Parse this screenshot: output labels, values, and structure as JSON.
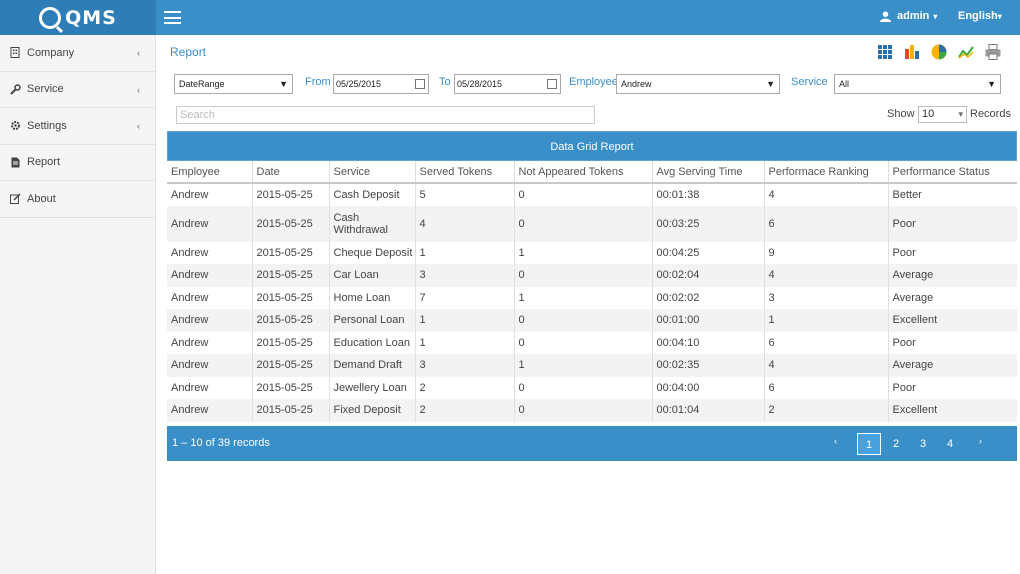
{
  "app": {
    "logo_text": "QMS"
  },
  "header": {
    "user": "admin",
    "language": "English"
  },
  "sidebar": {
    "items": [
      {
        "label": "Company",
        "icon": "building-icon"
      },
      {
        "label": "Service",
        "icon": "wrench-icon"
      },
      {
        "label": "Settings",
        "icon": "gear-icon"
      },
      {
        "label": "Report",
        "icon": "document-icon"
      },
      {
        "label": "About",
        "icon": "edit-icon"
      }
    ]
  },
  "main": {
    "breadcrumb": "Report",
    "filters": {
      "range_type": "DateRange",
      "from_label": "From",
      "from_value": "05/25/2015",
      "to_label": "To",
      "to_value": "05/28/2015",
      "employee_label": "Employee",
      "employee_value": "Andrew",
      "service_label": "Service",
      "service_value": "All"
    },
    "search_placeholder": "Search",
    "show_label": "Show",
    "show_value": "10",
    "records_label": "Records",
    "grid_title": "Data Grid Report",
    "columns": [
      "Employee",
      "Date",
      "Service",
      "Served Tokens",
      "Not Appeared Tokens",
      "Avg Serving Time",
      "Performace Ranking",
      "Performance Status"
    ],
    "rows": [
      [
        "Andrew",
        "2015-05-25",
        "Cash Deposit",
        "5",
        "0",
        "00:01:38",
        "4",
        "Better"
      ],
      [
        "Andrew",
        "2015-05-25",
        "Cash Withdrawal",
        "4",
        "0",
        "00:03:25",
        "6",
        "Poor"
      ],
      [
        "Andrew",
        "2015-05-25",
        "Cheque Deposit",
        "1",
        "1",
        "00:04:25",
        "9",
        "Poor"
      ],
      [
        "Andrew",
        "2015-05-25",
        "Car Loan",
        "3",
        "0",
        "00:02:04",
        "4",
        "Average"
      ],
      [
        "Andrew",
        "2015-05-25",
        "Home Loan",
        "7",
        "1",
        "00:02:02",
        "3",
        "Average"
      ],
      [
        "Andrew",
        "2015-05-25",
        "Personal Loan",
        "1",
        "0",
        "00:01:00",
        "1",
        "Excellent"
      ],
      [
        "Andrew",
        "2015-05-25",
        "Education Loan",
        "1",
        "0",
        "00:04:10",
        "6",
        "Poor"
      ],
      [
        "Andrew",
        "2015-05-25",
        "Demand Draft",
        "3",
        "1",
        "00:02:35",
        "4",
        "Average"
      ],
      [
        "Andrew",
        "2015-05-25",
        "Jewellery Loan",
        "2",
        "0",
        "00:04:00",
        "6",
        "Poor"
      ],
      [
        "Andrew",
        "2015-05-25",
        "Fixed Deposit",
        "2",
        "0",
        "00:01:04",
        "2",
        "Excellent"
      ]
    ],
    "pager": {
      "info": "1 – 10 of 39 records",
      "pages": [
        "1",
        "2",
        "3",
        "4"
      ],
      "active_page": "1"
    }
  },
  "colors": {
    "accent": "#3a8fc9",
    "logo_bg": "#2e7db7"
  }
}
